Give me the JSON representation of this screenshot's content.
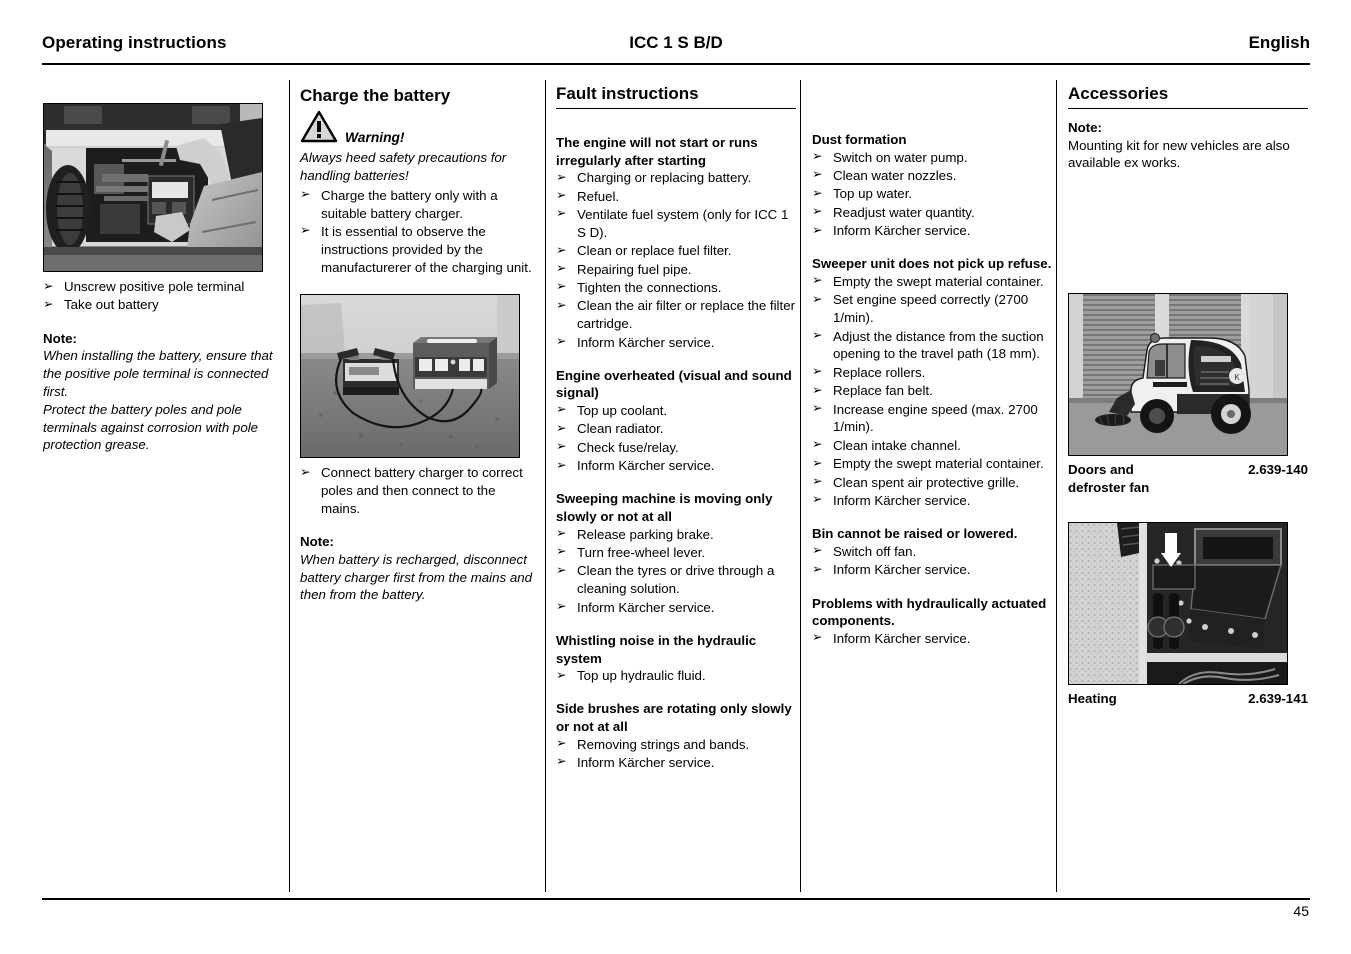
{
  "header": {
    "left": "Operating instructions",
    "center": "ICC 1 S B/D",
    "right": "English"
  },
  "footer": {
    "page_number": "45"
  },
  "column1": {
    "photo_caption_items": [
      "Unscrew positive pole terminal",
      "Take out battery"
    ],
    "note_label": "Note:",
    "note_paragraphs": [
      "When installing the battery, ensure that the positive pole terminal is connected first.",
      "Protect the battery poles and pole terminals against corrosion with pole protection grease."
    ]
  },
  "column2": {
    "title": "Charge the battery",
    "warning_label": "Warning!",
    "warning_text": "Always heed safety precautions for handling batteries!",
    "warning_items": [
      "Charge the battery only with a suitable battery charger.",
      "It is essential to observe the instructions provided by the manufacturerer of the charging unit."
    ],
    "charger_items": [
      "Connect battery charger to correct poles and then connect to the mains."
    ],
    "note_label": "Note:",
    "note_text": "When battery is recharged, disconnect battery charger first from the mains and then from the battery."
  },
  "column3": {
    "title": "Fault instructions",
    "sections": [
      {
        "heading": "The engine will not start or runs irregularly after starting",
        "items": [
          "Charging or replacing battery.",
          "Refuel.",
          "Ventilate fuel system (only for ICC 1 S D).",
          "Clean or replace fuel filter.",
          "Repairing fuel pipe.",
          "Tighten the connections.",
          "Clean the air filter or replace the filter cartridge.",
          "Inform Kärcher service."
        ]
      },
      {
        "heading": "Engine overheated (visual and sound signal)",
        "items": [
          "Top up coolant.",
          "Clean radiator.",
          "Check fuse/relay.",
          "Inform Kärcher service."
        ]
      },
      {
        "heading": "Sweeping machine is moving only slowly or not at all",
        "items": [
          "Release parking brake.",
          "Turn free-wheel lever.",
          "Clean the tyres or drive through a cleaning solution.",
          "Inform Kärcher service."
        ]
      },
      {
        "heading": "Whistling noise in the hydraulic system",
        "items": [
          "Top up hydraulic fluid."
        ]
      },
      {
        "heading": "Side brushes are rotating only slowly or not at all",
        "items": [
          "Removing strings and bands.",
          "Inform Kärcher service."
        ]
      }
    ]
  },
  "column4": {
    "sections": [
      {
        "heading": "Dust formation",
        "items": [
          "Switch on water pump.",
          "Clean water nozzles.",
          "Top up water.",
          "Readjust water quantity.",
          "Inform Kärcher service."
        ]
      },
      {
        "heading": "Sweeper unit does not pick up refuse.",
        "items": [
          "Empty the swept material container.",
          "Set engine speed correctly (2700 1/min).",
          "Adjust the distance from the suction opening to the travel path (18 mm).",
          "Replace rollers.",
          "Replace fan belt.",
          "Increase engine speed (max. 2700 1/min).",
          "Clean intake channel.",
          "Empty the swept material container.",
          "Clean spent air protective grille.",
          "Inform Kärcher service."
        ]
      },
      {
        "heading": "Bin cannot be raised or lowered.",
        "items": [
          "Switch off fan.",
          "Inform Kärcher service."
        ]
      },
      {
        "heading": "Problems with hydraulically actuated components.",
        "items": [
          "Inform Kärcher service."
        ]
      }
    ]
  },
  "column5": {
    "title": "Accessories",
    "note_label": "Note:",
    "note_text": "Mounting kit for new vehicles are also available ex works.",
    "accessories": [
      {
        "name": "Doors and\ndefroster fan",
        "part_number": "2.639-140"
      },
      {
        "name": "Heating",
        "part_number": "2.639-141"
      }
    ]
  }
}
